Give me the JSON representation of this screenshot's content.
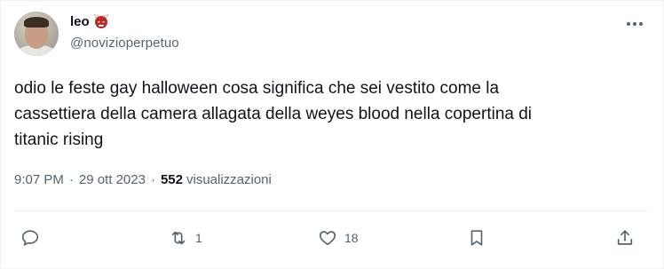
{
  "user": {
    "display_name": "leo",
    "badge_emoji": "👹",
    "handle": "@novizioperpetuo"
  },
  "tweet": {
    "text": "odio le feste gay halloween cosa significa che sei vestito come la\ncassettiera della camera allagata della weyes blood nella copertina di\ntitanic rising",
    "time": "9:07 PM",
    "date": "29 ott 2023",
    "separator": "·",
    "views_count": "552",
    "views_label": "visualizzazioni"
  },
  "actions": {
    "reply": {
      "icon": "reply-icon",
      "count": ""
    },
    "retweet": {
      "icon": "retweet-icon",
      "count": "1"
    },
    "like": {
      "icon": "heart-icon",
      "count": "18"
    },
    "bookmark": {
      "icon": "bookmark-icon",
      "count": ""
    },
    "share": {
      "icon": "share-icon",
      "count": ""
    }
  },
  "colors": {
    "text_primary": "#0f1419",
    "text_secondary": "#536471",
    "border": "#eff3f4",
    "badge_red": "#c62828"
  }
}
